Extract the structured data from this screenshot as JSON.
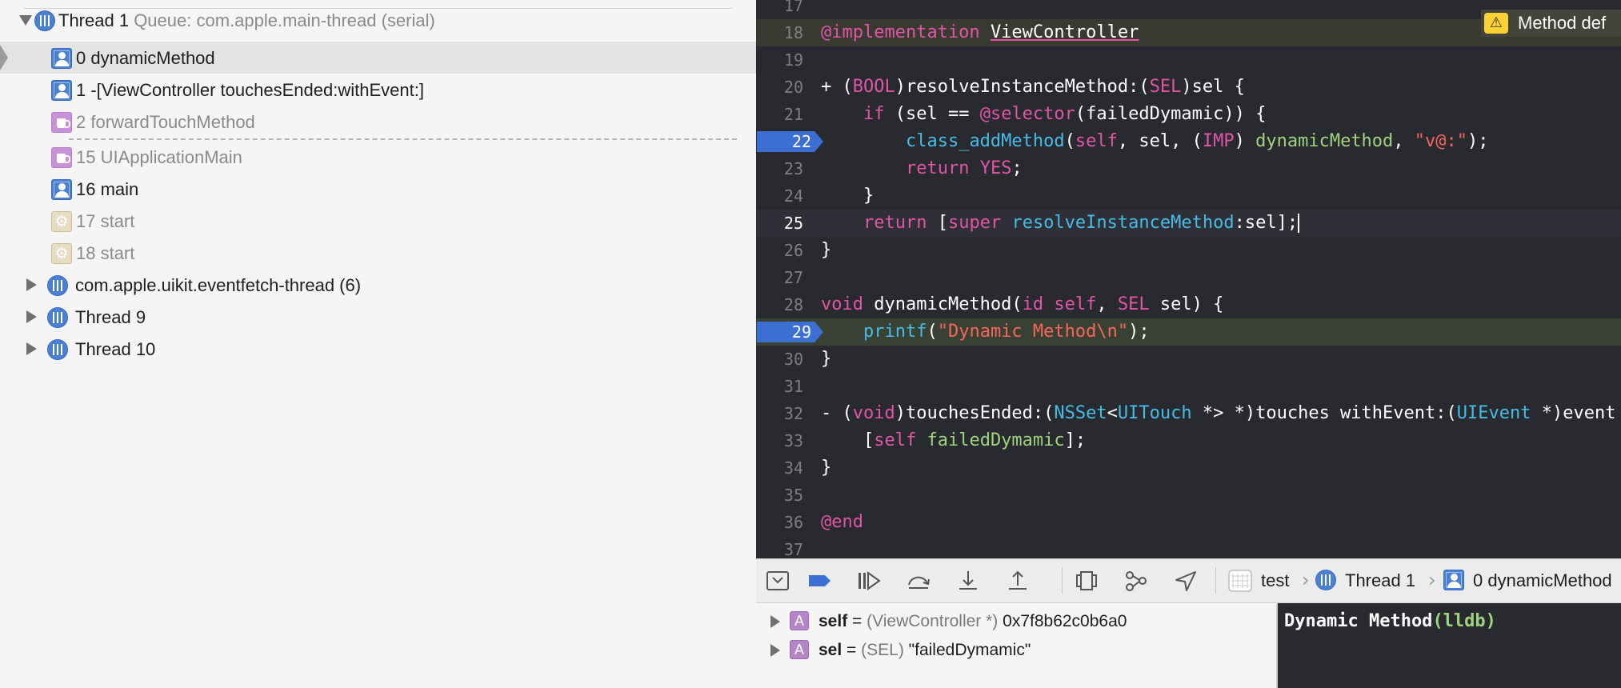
{
  "navigator": {
    "thread1": {
      "name": "Thread 1",
      "queue": "Queue: com.apple.main-thread (serial)"
    },
    "frames": [
      {
        "label": "0 dynamicMethod",
        "icon": "user-icon",
        "selected": true
      },
      {
        "label": "1 -[ViewController touchesEnded:withEvent:]",
        "icon": "user-icon"
      },
      {
        "label": "2 forwardTouchMethod",
        "icon": "cup-icon",
        "dim": true
      },
      {
        "label": "15 UIApplicationMain",
        "icon": "cup-icon",
        "dim": true
      },
      {
        "label": "16 main",
        "icon": "user-icon"
      },
      {
        "label": "17 start",
        "icon": "gear-icon",
        "dim": true
      },
      {
        "label": "18 start",
        "icon": "gear-icon",
        "dim": true
      }
    ],
    "other_threads": [
      "com.apple.uikit.eventfetch-thread (6)",
      "Thread 9",
      "Thread 10"
    ]
  },
  "editor": {
    "warning": "Method def",
    "lines": [
      {
        "n": "17",
        "segs": []
      },
      {
        "n": "18",
        "segs": [
          [
            "kw",
            "@implementation"
          ],
          [
            "plain",
            " "
          ],
          [
            "plain",
            "ViewController"
          ]
        ]
      },
      {
        "n": "19",
        "segs": []
      },
      {
        "n": "20",
        "segs": [
          [
            "plain",
            "+ ("
          ],
          [
            "kw",
            "BOOL"
          ],
          [
            "plain",
            ")resolveInstanceMethod:("
          ],
          [
            "kw",
            "SEL"
          ],
          [
            "plain",
            ")sel {"
          ]
        ]
      },
      {
        "n": "21",
        "segs": [
          [
            "plain",
            "    "
          ],
          [
            "kw",
            "if"
          ],
          [
            "plain",
            " (sel == "
          ],
          [
            "kw",
            "@selector"
          ],
          [
            "plain",
            "(failedDymamic)) {"
          ]
        ]
      },
      {
        "n": "22",
        "segs": [
          [
            "plain",
            "        "
          ],
          [
            "ty",
            "class_addMethod"
          ],
          [
            "plain",
            "("
          ],
          [
            "kw",
            "self"
          ],
          [
            "plain",
            ", sel, ("
          ],
          [
            "kw",
            "IMP"
          ],
          [
            "plain",
            ") "
          ],
          [
            "fn",
            "dynamicMethod"
          ],
          [
            "plain",
            ", "
          ],
          [
            "str",
            "\"v@:\""
          ],
          [
            "plain",
            ");"
          ]
        ],
        "breakpoint": true
      },
      {
        "n": "23",
        "segs": [
          [
            "plain",
            "        "
          ],
          [
            "kw",
            "return"
          ],
          [
            "plain",
            " "
          ],
          [
            "kw",
            "YES"
          ],
          [
            "plain",
            ";"
          ]
        ]
      },
      {
        "n": "24",
        "segs": [
          [
            "plain",
            "    }"
          ]
        ]
      },
      {
        "n": "25",
        "segs": [
          [
            "plain",
            "    "
          ],
          [
            "kw",
            "return"
          ],
          [
            "plain",
            " ["
          ],
          [
            "kw",
            "super"
          ],
          [
            "plain",
            " "
          ],
          [
            "ty",
            "resolveInstanceMethod"
          ],
          [
            "plain",
            ":sel];"
          ]
        ],
        "current": true
      },
      {
        "n": "26",
        "segs": [
          [
            "plain",
            "}"
          ]
        ]
      },
      {
        "n": "27",
        "segs": []
      },
      {
        "n": "28",
        "segs": [
          [
            "kw",
            "void"
          ],
          [
            "plain",
            " dynamicMethod("
          ],
          [
            "kw",
            "id"
          ],
          [
            "plain",
            " "
          ],
          [
            "kw",
            "self"
          ],
          [
            "plain",
            ", "
          ],
          [
            "kw",
            "SEL"
          ],
          [
            "plain",
            " sel) {"
          ]
        ]
      },
      {
        "n": "29",
        "segs": [
          [
            "plain",
            "    "
          ],
          [
            "ty",
            "printf"
          ],
          [
            "plain",
            "("
          ],
          [
            "str",
            "\"Dynamic Method\\n\""
          ],
          [
            "plain",
            ");"
          ]
        ],
        "breakpoint": true,
        "pc": true
      },
      {
        "n": "30",
        "segs": [
          [
            "plain",
            "}"
          ]
        ]
      },
      {
        "n": "31",
        "segs": []
      },
      {
        "n": "32",
        "segs": [
          [
            "plain",
            "- ("
          ],
          [
            "kw",
            "void"
          ],
          [
            "plain",
            ")touchesEnded:("
          ],
          [
            "ty",
            "NSSet"
          ],
          [
            "plain",
            "<"
          ],
          [
            "ty",
            "UITouch"
          ],
          [
            "plain",
            " *> *)touches withEvent:("
          ],
          [
            "ty",
            "UIEvent"
          ],
          [
            "plain",
            " *)event {"
          ]
        ]
      },
      {
        "n": "33",
        "segs": [
          [
            "plain",
            "    ["
          ],
          [
            "kw",
            "self"
          ],
          [
            "plain",
            " "
          ],
          [
            "fn",
            "failedDymamic"
          ],
          [
            "plain",
            "];"
          ]
        ]
      },
      {
        "n": "34",
        "segs": [
          [
            "plain",
            "}"
          ]
        ]
      },
      {
        "n": "35",
        "segs": []
      },
      {
        "n": "36",
        "segs": [
          [
            "kw",
            "@end"
          ]
        ]
      },
      {
        "n": "37",
        "segs": []
      }
    ]
  },
  "debug_bar": {
    "buttons": [
      "hide-debug-area-icon",
      "breakpoints-toggle-icon",
      "continue-icon",
      "step-over-icon",
      "step-into-icon",
      "step-out-icon",
      "view-hierarchy-icon",
      "memory-graph-icon",
      "simulate-location-icon"
    ],
    "breadcrumb": {
      "target": "test",
      "thread": "Thread 1",
      "frame": "0 dynamicMethod"
    }
  },
  "variables": [
    {
      "name": "self",
      "type": "(ViewController *)",
      "value": "0x7f8b62c0b6a0"
    },
    {
      "name": "sel",
      "type": "(SEL)",
      "value": "\"failedDymamic\""
    }
  ],
  "console": {
    "output": "Dynamic Method",
    "prompt": "(lldb)"
  },
  "colors": {
    "keyword": "#e055a4",
    "type": "#45bce6",
    "function": "#9fd37c",
    "string": "#f4665c",
    "breakpoint": "#3c6fd1",
    "editor_bg": "#292a30"
  }
}
